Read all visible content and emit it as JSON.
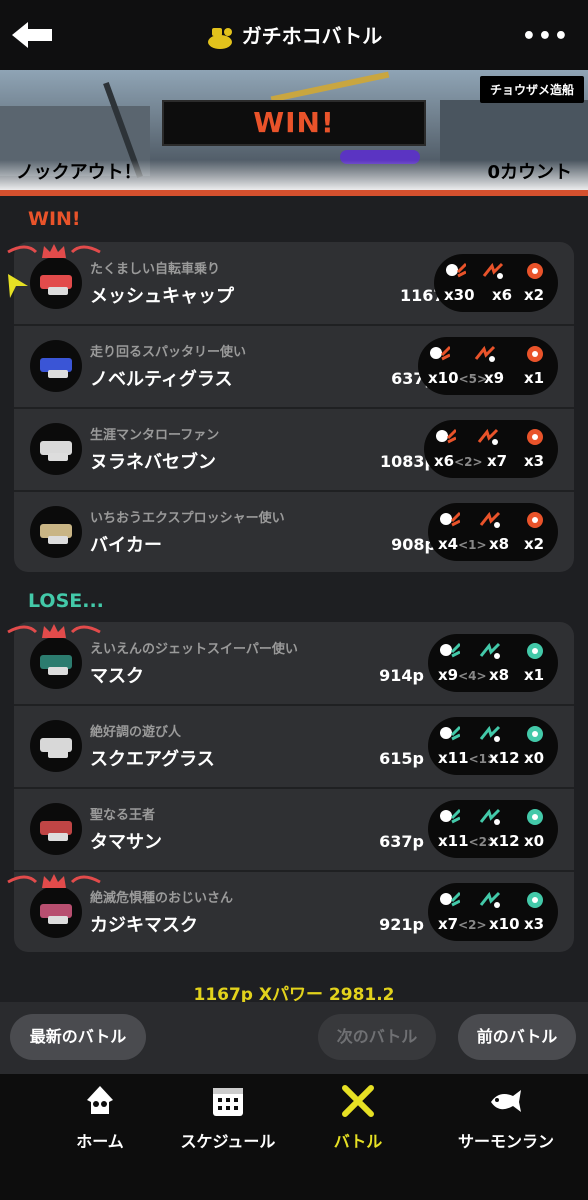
{
  "header": {
    "title": "ガチホコバトル",
    "back_icon": "back-arrow-icon",
    "more_icon": "more-icon"
  },
  "banner": {
    "stage_name": "チョウザメ造船",
    "result": "WIN!",
    "knockout": "ノックアウト！",
    "count": "0カウント"
  },
  "teams": {
    "win_label": "WIN!",
    "lose_label": "LOSE...",
    "win_players": [
      {
        "title": "たくましい自転車乗り",
        "name": "メッシュキャップ",
        "points": "1167p",
        "kills": "x30",
        "assists": "",
        "specials": "x6",
        "special_uses": "x2",
        "color": "#e24b4b"
      },
      {
        "title": "走り回るスパッタリー使い",
        "name": "ノベルティグラス",
        "points": "637p",
        "kills": "x10",
        "assists": "<5>",
        "specials": "x9",
        "special_uses": "x1",
        "color": "#3a55d6"
      },
      {
        "title": "生涯マンタローファン",
        "name": "ヌラネバセブン",
        "points": "1083p",
        "kills": "x6",
        "assists": "<2>",
        "specials": "x7",
        "special_uses": "x3",
        "color": "#d9d9d9"
      },
      {
        "title": "いちおうエクスプロッシャー使い",
        "name": "バイカー",
        "points": "908p",
        "kills": "x4",
        "assists": "<1>",
        "specials": "x8",
        "special_uses": "x2",
        "color": "#c9b585"
      }
    ],
    "lose_players": [
      {
        "title": "えいえんのジェットスイーパー使い",
        "name": "マスク",
        "points": "914p",
        "kills": "x9",
        "assists": "<4>",
        "specials": "x8",
        "special_uses": "x1",
        "color": "#2c7c6f"
      },
      {
        "title": "絶好調の遊び人",
        "name": "スクエアグラス",
        "points": "615p",
        "kills": "x11",
        "assists": "<1>",
        "specials": "x12",
        "special_uses": "x0",
        "color": "#d8d8d8"
      },
      {
        "title": "聖なる王者",
        "name": "タマサン",
        "points": "637p",
        "kills": "x11",
        "assists": "<2>",
        "specials": "x12",
        "special_uses": "x0",
        "color": "#c04545"
      },
      {
        "title": "絶滅危惧種のおじいさん",
        "name": "カジキマスク",
        "points": "921p",
        "kills": "x7",
        "assists": "<2>",
        "specials": "x10",
        "special_uses": "x3",
        "color": "#b84f70"
      }
    ]
  },
  "summary": {
    "text": "1167p Xパワー 2981.2"
  },
  "nav": {
    "latest": "最新のバトル",
    "next": "次のバトル",
    "prev": "前のバトル"
  },
  "tabs": [
    {
      "label": "ホーム",
      "icon": "squid-icon"
    },
    {
      "label": "スケジュール",
      "icon": "calendar-icon"
    },
    {
      "label": "バトル",
      "icon": "battle-icon"
    },
    {
      "label": "サーモンラン",
      "icon": "salmon-icon"
    }
  ],
  "colors": {
    "win": "#e9532a",
    "lose": "#43c9a9",
    "accent": "#e6e024"
  }
}
